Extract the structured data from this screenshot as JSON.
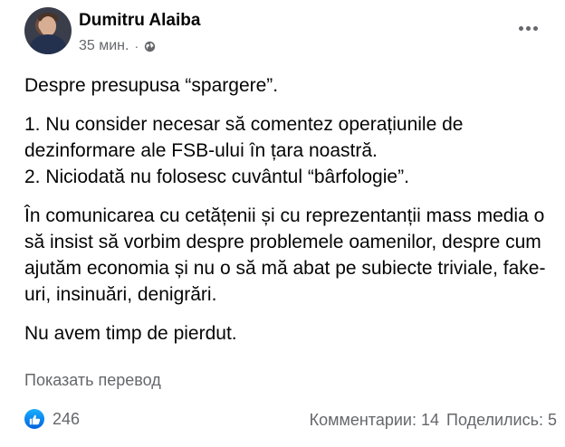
{
  "post": {
    "author": "Dumitru Alaiba",
    "time": "35 мин.",
    "separator": "·",
    "privacy_icon": "globe-icon",
    "more_icon": "more-horizontal-icon"
  },
  "content": {
    "intro": "Despre presupusa “spargere”.",
    "point1": "1. Nu consider necesar să comentez operațiunile de dezinformare ale FSB-ului în țara noastră.",
    "point2": "2. Niciodată nu folosesc cuvântul “bârfologie”.",
    "paragraph": "În comunicarea cu cetățenii și cu reprezentanții mass media o să insist să vorbim despre problemele oamenilor, despre cum ajutăm economia și nu o să mă abat pe subiecte triviale, fake-uri, insinuări, denigrări.",
    "closing": "Nu avem timp de pierdut."
  },
  "translate_link": "Показать перевод",
  "footer": {
    "reaction_icon": "like-icon",
    "reaction_count": "246",
    "comments": "Комментарии: 14",
    "shares": "Поделились: 5"
  },
  "colors": {
    "text": "#050505",
    "secondary": "#65676b",
    "like_blue": "#0062df"
  }
}
